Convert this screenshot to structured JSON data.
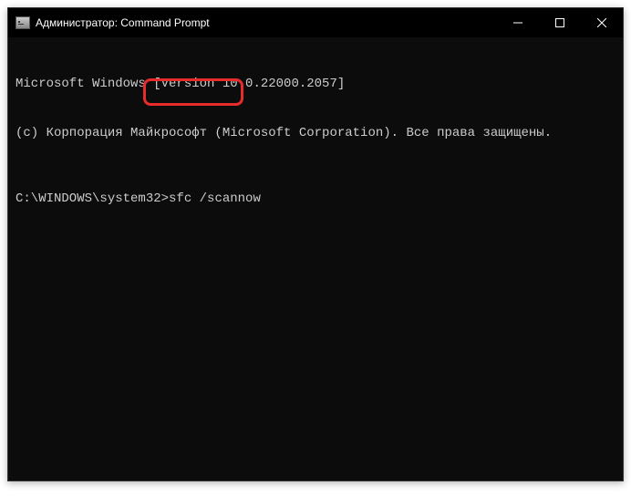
{
  "titlebar": {
    "title": "Администратор: Command Prompt"
  },
  "terminal": {
    "line1": "Microsoft Windows [Version 10.0.22000.2057]",
    "line2": "(c) Корпорация Майкрософт (Microsoft Corporation). Все права защищены.",
    "prompt": "C:\\WINDOWS\\system32>",
    "command": "sfc /scannow"
  }
}
